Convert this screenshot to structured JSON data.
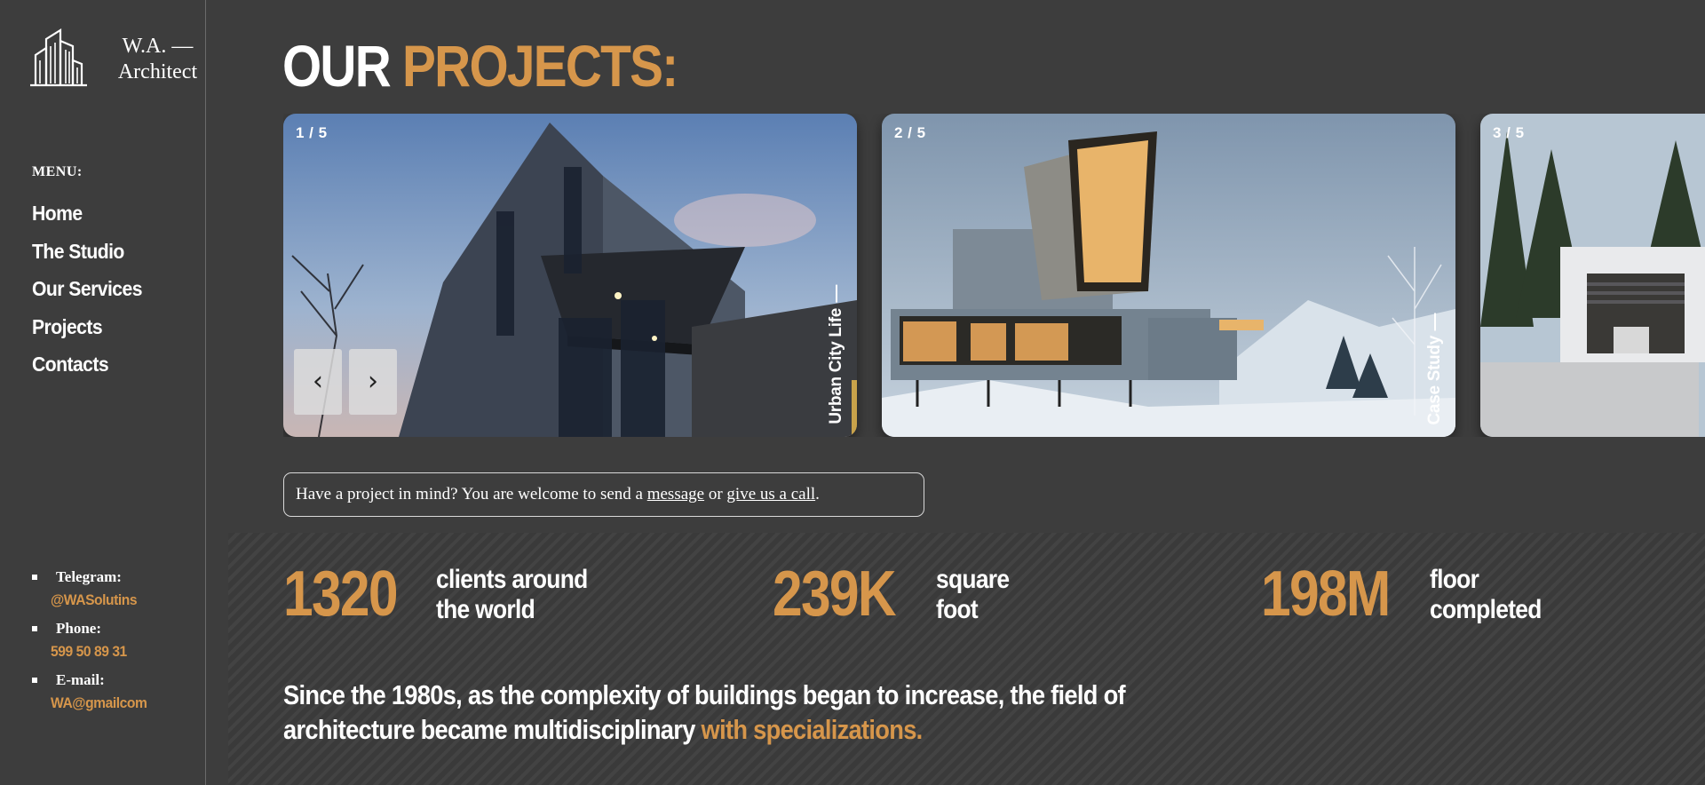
{
  "brand": {
    "logo_text": "W.A. — Architect",
    "logo_icon": "building-icon"
  },
  "sidebar": {
    "menu_title": "MENU:",
    "nav": [
      {
        "label": "Home"
      },
      {
        "label": "The Studio"
      },
      {
        "label": "Our Services"
      },
      {
        "label": "Projects"
      },
      {
        "label": "Contacts"
      }
    ],
    "contacts": [
      {
        "label": "Telegram:",
        "value": "@WASolutins"
      },
      {
        "label": "Phone:",
        "value": "599 50 89 31"
      },
      {
        "label": "E-mail:",
        "value": "WA@gmailcom"
      }
    ]
  },
  "main": {
    "title_part1": "OUR",
    "title_part2": "PROJECTS:",
    "slides": [
      {
        "counter": "1 / 5",
        "caption": "Urban City Life"
      },
      {
        "counter": "2 / 5",
        "caption": "Case Study"
      },
      {
        "counter": "3 / 5",
        "caption": ""
      }
    ],
    "prev_arrow": "‹",
    "next_arrow": "›",
    "notice": {
      "text_before": "Have a project in mind? You are welcome to send a",
      "link_message": "message",
      "text_middle": "or",
      "link_call": "give us a call",
      "text_after": "."
    },
    "stats": [
      {
        "number": "1320",
        "label": "clients around the world"
      },
      {
        "number": "239K",
        "label": "square foot"
      },
      {
        "number": "198M",
        "label": "floor completed"
      }
    ],
    "bottom_text_main": "Since the 1980s, as the complexity of buildings began to increase, the field of architecture became multidisciplinary",
    "bottom_text_accent": "with specializations."
  },
  "colors": {
    "background": "#3d3d3d",
    "accent": "#d6964b",
    "text": "#ffffff"
  }
}
